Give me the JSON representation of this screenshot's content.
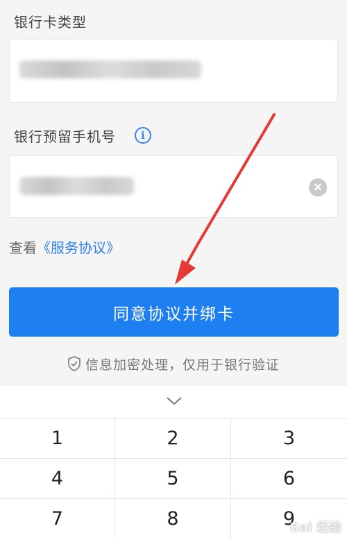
{
  "form": {
    "card_type_label": "银行卡类型",
    "phone_label": "银行预留手机号",
    "terms_prefix": "查看",
    "terms_link": "《服务协议》",
    "submit_label": "同意协议并绑卡",
    "secure_note": "信息加密处理，仅用于银行验证"
  },
  "keyboard": {
    "keys": [
      "1",
      "2",
      "3",
      "4",
      "5",
      "6",
      "7",
      "8",
      "9"
    ]
  },
  "watermark": "Bai 经验",
  "colors": {
    "accent": "#1e7ff0",
    "link": "#2f7de6",
    "annotation_arrow": "#e53935"
  },
  "icons": {
    "info": "info-circle-icon",
    "clear": "clear-circle-icon",
    "shield": "shield-check-icon",
    "collapse": "chevron-down-icon"
  }
}
